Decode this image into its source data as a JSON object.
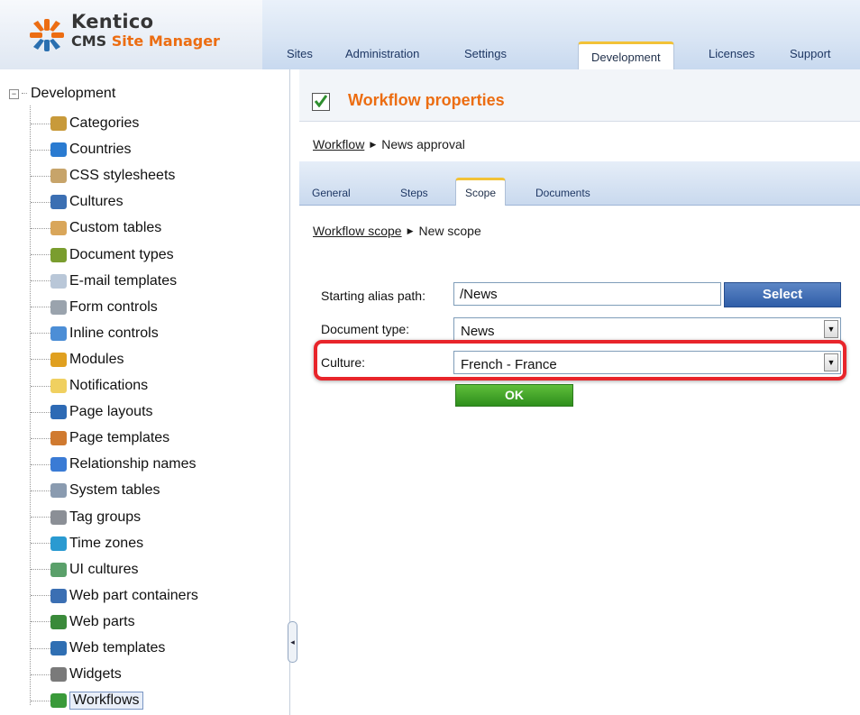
{
  "header": {
    "logo_title": "Kentico",
    "logo_sub_part1": "CMS ",
    "logo_sub_part2": "Site Manager",
    "menu": [
      "Sites",
      "Administration",
      "Settings",
      "Development",
      "Licenses",
      "Support"
    ],
    "active_menu": "Development"
  },
  "tree": {
    "root": "Development",
    "items": [
      {
        "label": "Categories",
        "icon": "categories-icon",
        "color": "#c89a3a"
      },
      {
        "label": "Countries",
        "icon": "globe-icon",
        "color": "#2a7bd1"
      },
      {
        "label": "CSS stylesheets",
        "icon": "brush-icon",
        "color": "#c7a46a"
      },
      {
        "label": "Cultures",
        "icon": "culture-globe-icon",
        "color": "#3b6fb3"
      },
      {
        "label": "Custom tables",
        "icon": "table-icon",
        "color": "#d9a65a"
      },
      {
        "label": "Document types",
        "icon": "book-icon",
        "color": "#7a9d2e"
      },
      {
        "label": "E-mail templates",
        "icon": "envelope-icon",
        "color": "#b9c7d8"
      },
      {
        "label": "Form controls",
        "icon": "pencil-icon",
        "color": "#9aa3ad"
      },
      {
        "label": "Inline controls",
        "icon": "inline-control-icon",
        "color": "#4c8ed6"
      },
      {
        "label": "Modules",
        "icon": "modules-icon",
        "color": "#e0a020"
      },
      {
        "label": "Notifications",
        "icon": "notification-icon",
        "color": "#f0d060"
      },
      {
        "label": "Page layouts",
        "icon": "layout-icon",
        "color": "#2d6ab5"
      },
      {
        "label": "Page templates",
        "icon": "template-icon",
        "color": "#d07a30"
      },
      {
        "label": "Relationship names",
        "icon": "relationship-icon",
        "color": "#3a7bd5"
      },
      {
        "label": "System tables",
        "icon": "grid-icon",
        "color": "#8a9bb0"
      },
      {
        "label": "Tag groups",
        "icon": "tag-icon",
        "color": "#8b8f96"
      },
      {
        "label": "Time zones",
        "icon": "timezone-globe-icon",
        "color": "#2a9ad1"
      },
      {
        "label": "UI cultures",
        "icon": "ui-culture-icon",
        "color": "#5aa06a"
      },
      {
        "label": "Web part containers",
        "icon": "container-icon",
        "color": "#3b6fb3"
      },
      {
        "label": "Web parts",
        "icon": "puzzle-icon",
        "color": "#3a8a3a"
      },
      {
        "label": "Web templates",
        "icon": "web-template-icon",
        "color": "#2f6fb3"
      },
      {
        "label": "Widgets",
        "icon": "widget-icon",
        "color": "#7a7a7a"
      },
      {
        "label": "Workflows",
        "icon": "workflow-check-icon",
        "color": "#3a9a3a",
        "selected": true
      }
    ]
  },
  "content": {
    "title": "Workflow properties",
    "breadcrumb1_link": "Workflow",
    "breadcrumb1_current": "News approval",
    "tabs": [
      "General",
      "Steps",
      "Scope",
      "Documents"
    ],
    "active_tab": "Scope",
    "breadcrumb2_link": "Workflow scope",
    "breadcrumb2_current": "New scope",
    "form": {
      "alias_label": "Starting alias path:",
      "alias_value": "/News",
      "select_label": "Select",
      "doctype_label": "Document type:",
      "doctype_value": "News",
      "culture_label": "Culture:",
      "culture_value": "French - France",
      "ok_label": "OK"
    },
    "highlight_color": "#e8252b",
    "title_color": "#ec6d12"
  }
}
